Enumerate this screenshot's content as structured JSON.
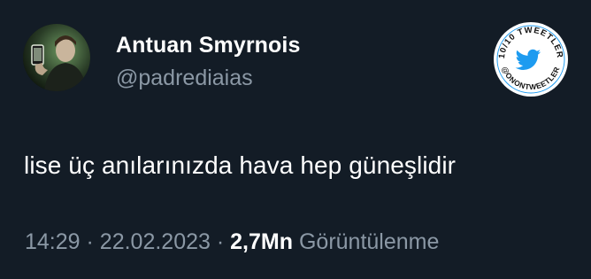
{
  "tweet": {
    "author": {
      "display_name": "Antuan Smyrnois",
      "handle": "@padrediaias",
      "avatar_icon": "profile-photo"
    },
    "text": "lise üç anılarınızda hava hep güneşlidir",
    "time": "14:29",
    "separator": "·",
    "date": "22.02.2023",
    "views_count": "2,7Mn",
    "views_label": "Görüntülenme"
  },
  "badge": {
    "top_text": "10/10 TWEETLER",
    "bottom_text": "@ONONTWEETLER",
    "icon": "twitter-bird-icon",
    "accent_color": "#1d9bf0"
  },
  "colors": {
    "background": "#131c26",
    "primary_text": "#ffffff",
    "secondary_text": "#8b98a5"
  }
}
